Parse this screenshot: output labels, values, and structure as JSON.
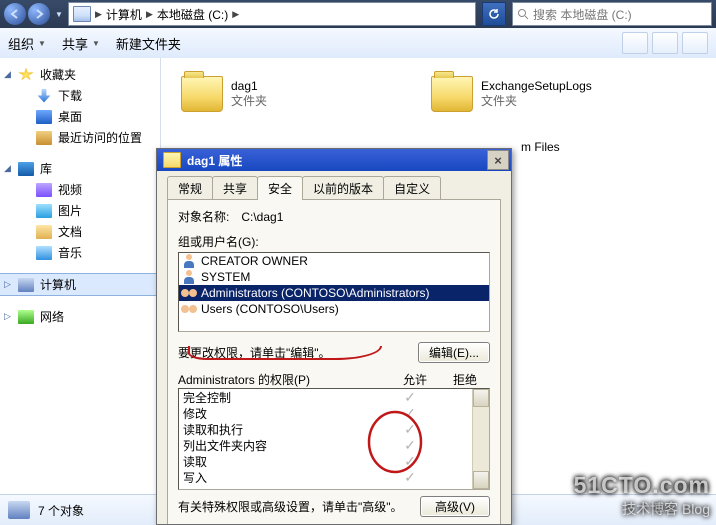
{
  "nav": {
    "crumbs": [
      "计算机",
      "本地磁盘 (C:)"
    ],
    "search_placeholder": "搜索 本地磁盘 (C:)"
  },
  "toolbar": {
    "organize": "组织",
    "share": "共享",
    "new_folder": "新建文件夹"
  },
  "tree": {
    "favorites": {
      "label": "收藏夹",
      "items": [
        "下载",
        "桌面",
        "最近访问的位置"
      ]
    },
    "libraries": {
      "label": "库",
      "items": [
        "视频",
        "图片",
        "文档",
        "音乐"
      ]
    },
    "computer": "计算机",
    "network": "网络"
  },
  "tiles": {
    "dag1": {
      "name": "dag1",
      "type": "文件夹"
    },
    "exch": {
      "name": "ExchangeSetupLogs",
      "type": "文件夹"
    },
    "pfiles": {
      "suffix": "m Files"
    }
  },
  "status": {
    "count": "7 个对象"
  },
  "dialog": {
    "title": "dag1 属性",
    "tabs": [
      "常规",
      "共享",
      "安全",
      "以前的版本",
      "自定义"
    ],
    "active_tab_index": 2,
    "object_label": "对象名称:",
    "object_value": "C:\\dag1",
    "groups_label": "组或用户名(G):",
    "principals": [
      "CREATOR OWNER",
      "SYSTEM",
      "Administrators (CONTOSO\\Administrators)",
      "Users (CONTOSO\\Users)"
    ],
    "selected_principal_index": 2,
    "edit_hint": "要更改权限，请单击\"编辑\"。",
    "edit_btn": "编辑(E)...",
    "perm_label": "Administrators 的权限(P)",
    "perm_allow": "允许",
    "perm_deny": "拒绝",
    "permissions": [
      "完全控制",
      "修改",
      "读取和执行",
      "列出文件夹内容",
      "读取",
      "写入"
    ],
    "adv_hint": "有关特殊权限或高级设置，请单击\"高级\"。",
    "adv_btn": "高级(V)"
  },
  "watermark": {
    "l1": "51CTO.com",
    "l2": "技术博客    Blog"
  }
}
